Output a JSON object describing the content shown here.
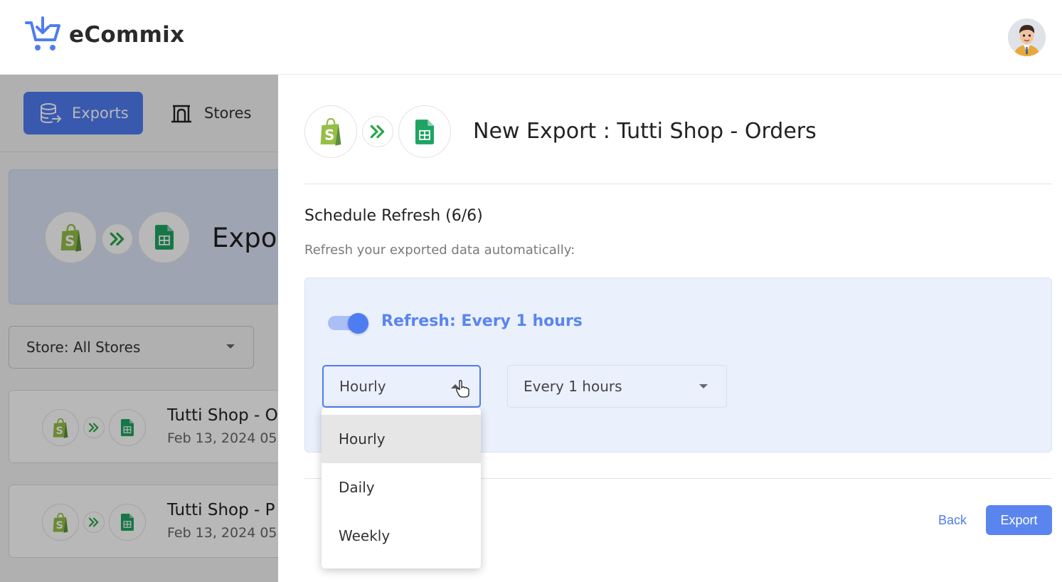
{
  "app": {
    "name": "eCommix"
  },
  "nav": {
    "exports_label": "Exports",
    "stores_label": "Stores"
  },
  "background": {
    "hero_title": "Expor",
    "store_filter": "Store: All Stores",
    "exports": [
      {
        "title": "Tutti Shop - O",
        "date": "Feb 13, 2024 05"
      },
      {
        "title": "Tutti Shop - P",
        "date": "Feb 13, 2024 05"
      }
    ]
  },
  "panel": {
    "title": "New Export : Tutti Shop - Orders",
    "section_title": "Schedule Refresh (6/6)",
    "section_subtitle": "Refresh your exported data automatically:",
    "refresh_label": "Refresh: Every 1 hours",
    "refresh_enabled": true,
    "frequency": {
      "selected": "Hourly",
      "options": [
        "Hourly",
        "Daily",
        "Weekly"
      ]
    },
    "interval": {
      "selected": "Every 1 hours"
    },
    "back_label": "Back",
    "export_label": "Export"
  },
  "colors": {
    "accent": "#4e7cf2",
    "shopify_green": "#95bf47",
    "sheets_green": "#1fa463",
    "arrow_green": "#2aa84a"
  },
  "icons": {
    "logo": "cart-download-icon",
    "exports": "database-export-icon",
    "stores": "store-icon",
    "source": "shopify-icon",
    "arrow": "double-chevron-right-icon",
    "destination": "google-sheets-icon"
  }
}
